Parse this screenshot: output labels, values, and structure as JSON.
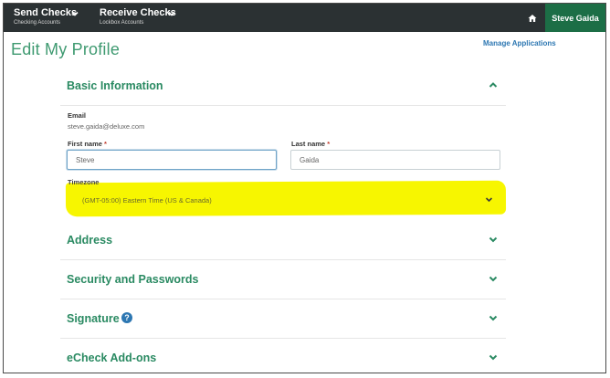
{
  "topbar": {
    "menus": [
      {
        "title": "Send Checks",
        "subtitle": "Checking Accounts"
      },
      {
        "title": "Receive Checks",
        "subtitle": "Lockbox Accounts"
      }
    ],
    "user_name": "Steve Gaida"
  },
  "page": {
    "title": "Edit My Profile",
    "manage_link": "Manage Applications"
  },
  "basic_info": {
    "title": "Basic Information",
    "email_label": "Email",
    "email_value": "steve.gaida@deluxe.com",
    "first_name_label": "First name",
    "first_name_value": "Steve",
    "last_name_label": "Last name",
    "last_name_value": "Gaida",
    "required_marker": "*",
    "timezone_label": "Timezone",
    "timezone_value": "(GMT-05:00) Eastern Time (US & Canada)"
  },
  "sections": [
    {
      "title": "Address"
    },
    {
      "title": "Security and Passwords"
    },
    {
      "title": "Signature"
    },
    {
      "title": "eCheck Add-ons"
    }
  ],
  "colors": {
    "topbar": "#2b3133",
    "user_button": "#1c6e46",
    "accent_green": "#2a8a62",
    "link_blue": "#2d77b2",
    "highlight_yellow": "#f7f600"
  },
  "icons": {
    "menu_chevron": "chevron-down-icon",
    "home": "home-icon",
    "section_open": "chevron-up-icon",
    "section_closed": "chevron-down-icon",
    "help": "help-icon"
  }
}
